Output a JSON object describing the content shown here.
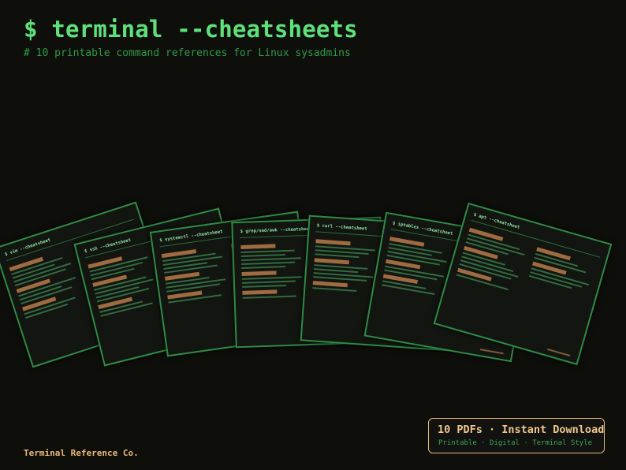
{
  "header": {
    "title": "$ terminal --cheatsheets",
    "subtitle": "# 10 printable command references for Linux sysadmins"
  },
  "brand": "Terminal Reference Co.",
  "badge": {
    "title": "10 PDFs · Instant Download",
    "subtitle": "Printable · Digital · Terminal Style"
  },
  "sheets": [
    {
      "title": "$ vim --cheatsheet"
    },
    {
      "title": "$ ssh --cheatsheet"
    },
    {
      "title": "$ systemctl --cheatsheet"
    },
    {
      "title": "$ grep/sed/awk --cheatsheet"
    },
    {
      "title": "$ curl --cheatsheet"
    },
    {
      "title": "$ iptables --cheatsheet"
    },
    {
      "title": "$ apt --cheatsheet"
    }
  ],
  "colors": {
    "background": "#0e0f0b",
    "accent_green": "#5fe07a",
    "dim_green": "#2f9a49",
    "sheet_border": "#2f8a45",
    "accent_orange": "#e8b87a"
  }
}
